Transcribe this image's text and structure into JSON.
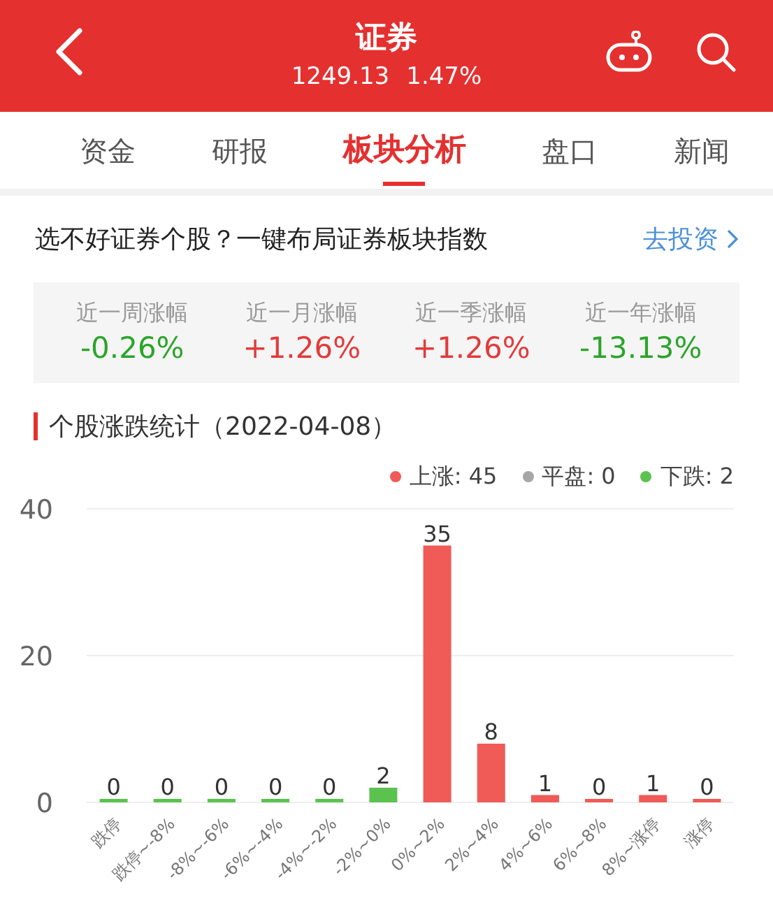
{
  "header": {
    "title": "证券",
    "price": "1249.13",
    "change": "1.47%"
  },
  "tabs": [
    {
      "label": "资金",
      "selected": false
    },
    {
      "label": "研报",
      "selected": false
    },
    {
      "label": "板块分析",
      "selected": true
    },
    {
      "label": "盘口",
      "selected": false
    },
    {
      "label": "新闻",
      "selected": false
    }
  ],
  "promo": {
    "text": "选不好证券个股？一键布局证券板块指数",
    "link": "去投资"
  },
  "stats": [
    {
      "label": "近一周涨幅",
      "value": "-0.26%",
      "color": "#2aa52a"
    },
    {
      "label": "近一月涨幅",
      "value": "+1.26%",
      "color": "#e23b3b"
    },
    {
      "label": "近一季涨幅",
      "value": "+1.26%",
      "color": "#e23b3b"
    },
    {
      "label": "近一年涨幅",
      "value": "-13.13%",
      "color": "#2aa52a"
    }
  ],
  "section_title": "个股涨跌统计（2022-04-08）",
  "legend": [
    {
      "label": "上涨: 45",
      "color": "#f05a57"
    },
    {
      "label": "平盘: 0",
      "color": "#a6a6a6"
    },
    {
      "label": "下跌: 2",
      "color": "#5cc24f"
    }
  ],
  "chart_data": {
    "type": "bar",
    "categories": [
      "跌停",
      "跌停~-8%",
      "-8%~-6%",
      "-6%~-4%",
      "-4%~-2%",
      "-2%~0%",
      "0%~2%",
      "2%~4%",
      "4%~6%",
      "6%~8%",
      "8%~涨停",
      "涨停"
    ],
    "series": [
      {
        "color": "#5cc24f",
        "values": [
          0,
          0,
          0,
          0,
          0,
          2,
          null,
          null,
          null,
          null,
          null,
          null
        ]
      },
      {
        "color": "#f05a57",
        "values": [
          null,
          null,
          null,
          null,
          null,
          null,
          35,
          8,
          1,
          0,
          1,
          0
        ]
      }
    ],
    "stacked": true,
    "ylim": [
      0,
      40
    ],
    "yticks": [
      0,
      20,
      40
    ],
    "data_labels": true
  }
}
